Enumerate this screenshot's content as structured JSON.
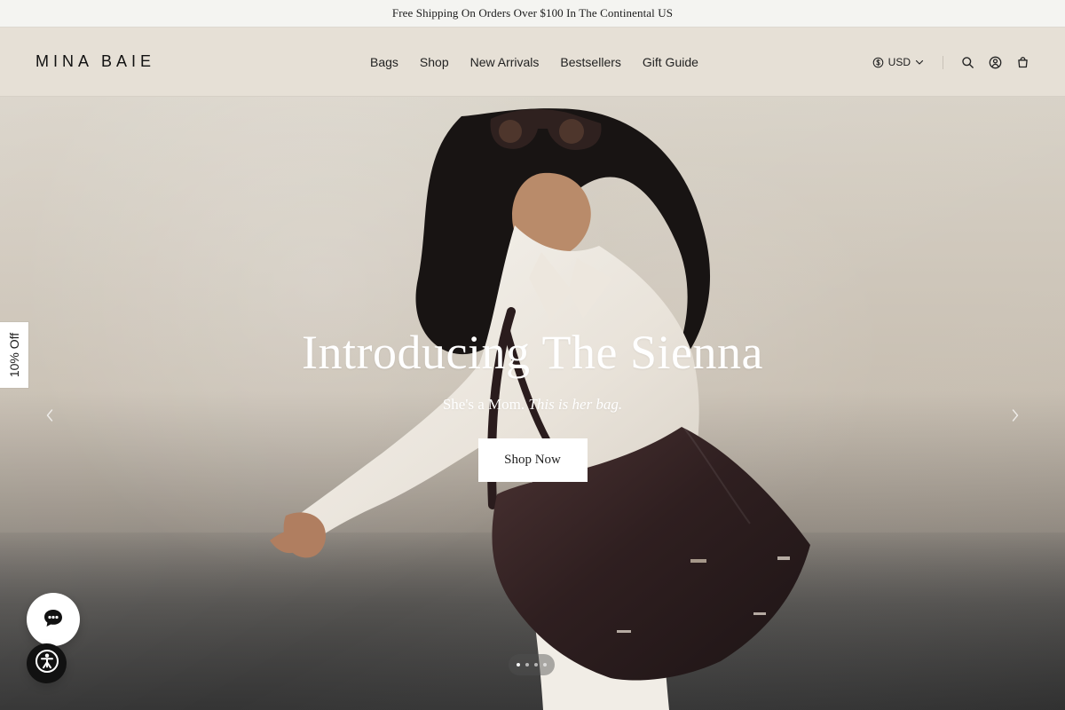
{
  "announcement": {
    "text": "Free Shipping On Orders Over $100 In The Continental US"
  },
  "header": {
    "logo": "MINA BAIE",
    "nav": [
      {
        "label": "Bags"
      },
      {
        "label": "Shop"
      },
      {
        "label": "New Arrivals"
      },
      {
        "label": "Bestsellers"
      },
      {
        "label": "Gift Guide"
      }
    ],
    "currency": "USD",
    "icons": {
      "currency": "dollar-circle-icon",
      "dropdown": "chevron-down-icon",
      "search": "search-icon",
      "account": "account-icon",
      "cart": "bag-icon"
    }
  },
  "hero": {
    "title": "Introducing The Sienna",
    "subtitle_lead": "She's a Mom.",
    "subtitle_italic": "This is her bag.",
    "cta": "Shop Now",
    "side_tab": "10% Off",
    "carousel": {
      "active_slide": 1,
      "total_slides": 4
    }
  },
  "widgets": {
    "chat_icon": "chat-icon",
    "accessibility_icon": "accessibility-icon",
    "arrow_left_icon": "chevron-left-icon",
    "arrow_right_icon": "chevron-right-icon"
  },
  "colors": {
    "announcement_bg": "#f4f4f1",
    "header_bg": "#e6e0d6",
    "hero_text": "#ffffff",
    "button_bg": "#ffffff",
    "accessibility_bg": "#111111"
  }
}
